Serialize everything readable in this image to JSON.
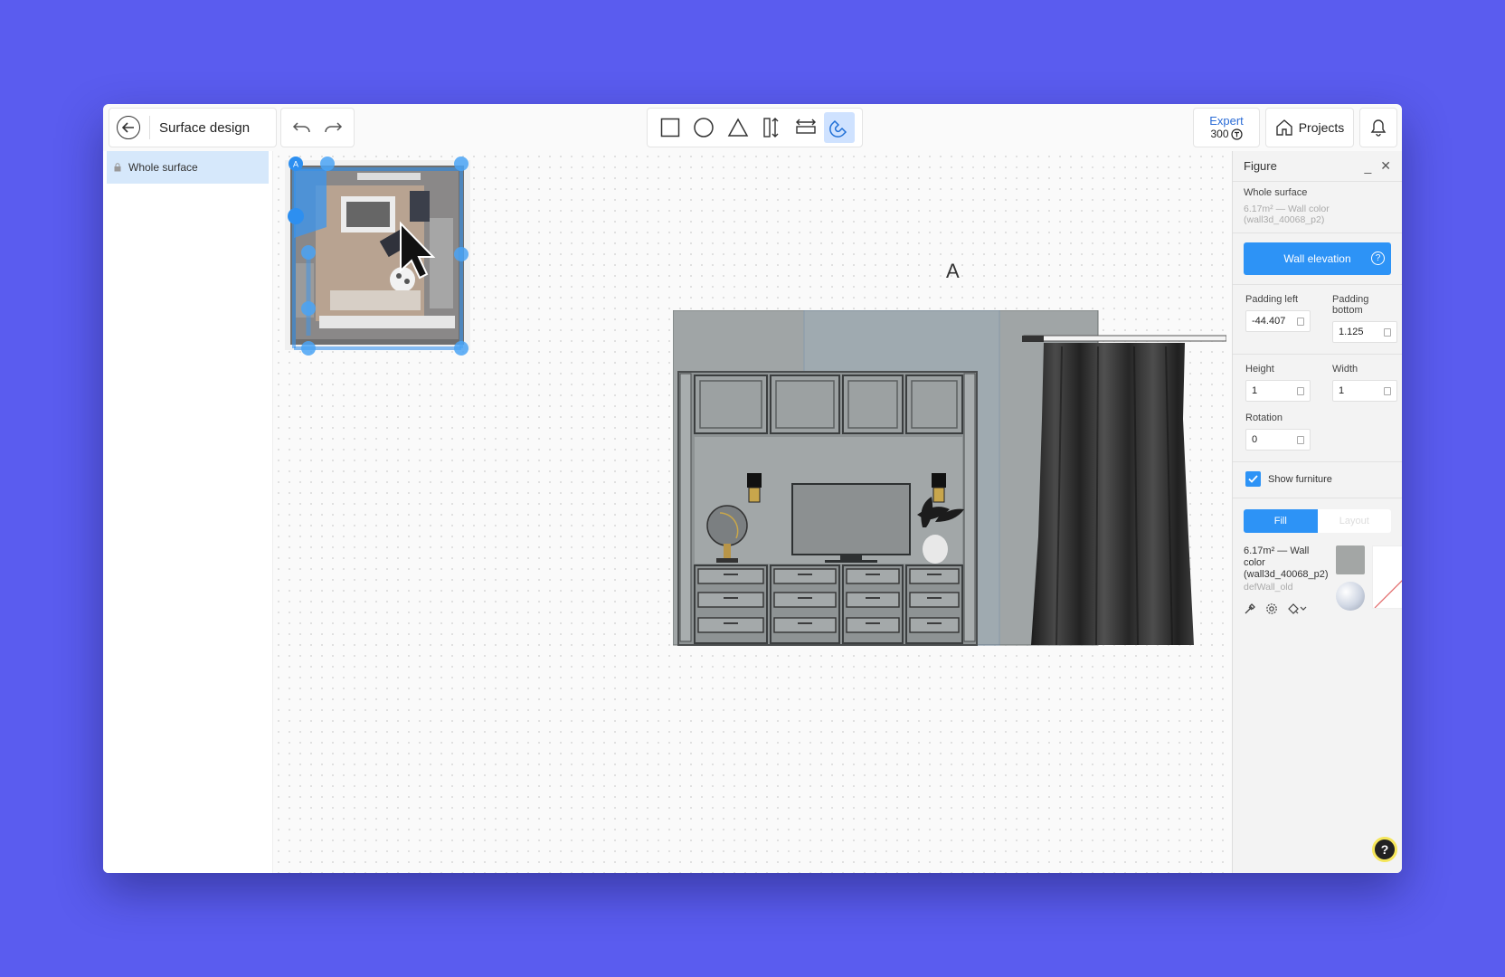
{
  "header": {
    "title": "Surface design",
    "expert_label": "Expert",
    "expert_value": "300",
    "projects_label": "Projects"
  },
  "toolbar": {
    "tools": [
      "rectangle-icon",
      "circle-icon",
      "triangle-icon",
      "vertical-dimension-icon",
      "horizontal-dimension-icon",
      "magnet-icon"
    ],
    "active_tool": "magnet-icon"
  },
  "sidebar": {
    "items": [
      {
        "label": "Whole surface",
        "selected": true
      }
    ]
  },
  "canvas": {
    "elevation_label": "A",
    "minimap_marker": "A"
  },
  "panel": {
    "title": "Figure",
    "subtitle": "Whole surface",
    "description": "6.17m² — Wall color (wall3d_40068_p2)",
    "wall_elevation_button": "Wall elevation",
    "padding_left": {
      "label": "Padding left",
      "value": "-44.407"
    },
    "padding_bottom": {
      "label": "Padding bottom",
      "value": "1.125"
    },
    "height": {
      "label": "Height",
      "value": "1"
    },
    "width": {
      "label": "Width",
      "value": "1"
    },
    "rotation": {
      "label": "Rotation",
      "value": "0"
    },
    "show_furniture": {
      "label": "Show furniture",
      "checked": true
    },
    "tabs": [
      {
        "label": "Fill",
        "active": true
      },
      {
        "label": "Layout",
        "active": false
      }
    ],
    "material": {
      "area_line1": "6.17m² — Wall color",
      "area_line2": "(wall3d_40068_p2)",
      "code": "defWall_old"
    }
  },
  "colors": {
    "background": "#5a5cef",
    "accent": "#2d93f6",
    "wall_swatch": "#a3a6a5"
  }
}
